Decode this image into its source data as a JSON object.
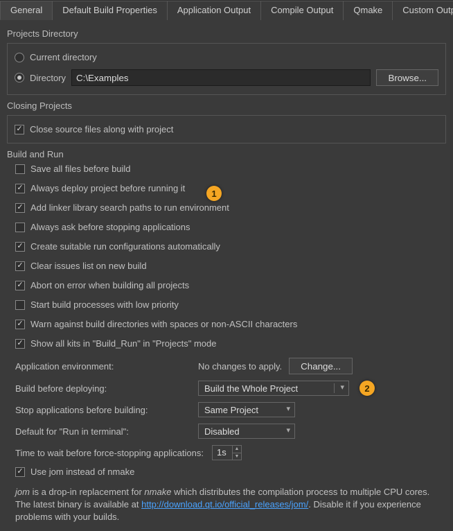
{
  "tabs": [
    "General",
    "Default Build Properties",
    "Application Output",
    "Compile Output",
    "Qmake",
    "Custom Output Parsers"
  ],
  "active_tab": 0,
  "projects_dir": {
    "title": "Projects Directory",
    "option_current": "Current directory",
    "option_dir": "Directory",
    "path": "C:\\Examples",
    "browse": "Browse..."
  },
  "closing": {
    "title": "Closing Projects",
    "close_sources": {
      "label": "Close source files along with project",
      "checked": true
    }
  },
  "build_run": {
    "title": "Build and Run",
    "checks": [
      {
        "label": "Save all files before build",
        "checked": false
      },
      {
        "label": "Always deploy project before running it",
        "checked": true
      },
      {
        "label": "Add linker library search paths to run environment",
        "checked": true
      },
      {
        "label": "Always ask before stopping applications",
        "checked": false
      },
      {
        "label": "Create suitable run configurations automatically",
        "checked": true
      },
      {
        "label": "Clear issues list on new build",
        "checked": true
      },
      {
        "label": "Abort on error when building all projects",
        "checked": true
      },
      {
        "label": "Start build processes with low priority",
        "checked": false
      },
      {
        "label": "Warn against build directories with spaces or non-ASCII characters",
        "checked": true
      },
      {
        "label": "Show all kits in \"Build_Run\" in \"Projects\" mode",
        "checked": true
      }
    ],
    "app_env_label": "Application environment:",
    "app_env_status": "No changes to apply.",
    "change_btn": "Change...",
    "build_before_deploy_label": "Build before deploying:",
    "build_before_deploy_value": "Build the Whole Project",
    "stop_apps_label": "Stop applications before building:",
    "stop_apps_value": "Same Project",
    "default_terminal_label": "Default for \"Run in terminal\":",
    "default_terminal_value": "Disabled",
    "wait_label": "Time to wait before force-stopping applications:",
    "wait_value": "1s",
    "use_jom": {
      "label": "Use jom instead of nmake",
      "checked": true
    },
    "note_1": "jom",
    "note_2": " is a drop-in replacement for ",
    "note_3": "nmake",
    "note_4": " which distributes the compilation process to multiple CPU cores. The latest binary is available at ",
    "note_link": "http://download.qt.io/official_releases/jom/",
    "note_5": ". Disable it if you experience problems with your builds."
  },
  "callouts": {
    "one": "1",
    "two": "2"
  }
}
